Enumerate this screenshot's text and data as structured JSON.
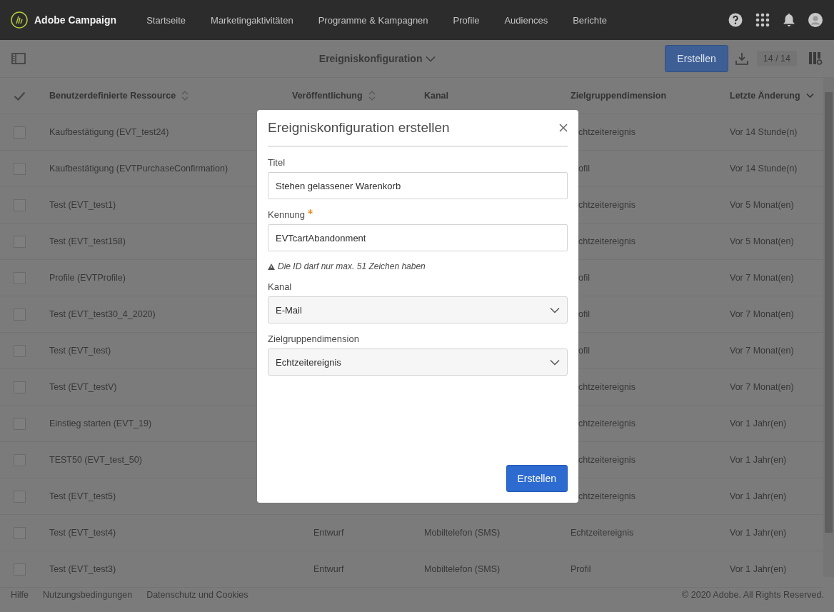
{
  "header": {
    "logo": "Adobe Campaign",
    "nav": [
      "Startseite",
      "Marketingaktivitäten",
      "Programme & Kampagnen",
      "Profile",
      "Audiences",
      "Berichte"
    ]
  },
  "toolbar": {
    "title": "Ereigniskonfiguration",
    "create_button": "Erstellen",
    "count": "14 / 14"
  },
  "table": {
    "columns": [
      {
        "label": "Benutzerdefinierte Ressource",
        "sortable": true,
        "sorted": false
      },
      {
        "label": "Veröffentlichung",
        "sortable": true,
        "sorted": false
      },
      {
        "label": "Kanal",
        "sortable": false,
        "sorted": false
      },
      {
        "label": "Zielgruppendimension",
        "sortable": false,
        "sorted": false
      },
      {
        "label": "Letzte Änderung",
        "sortable": true,
        "sorted": true
      }
    ],
    "rows": [
      {
        "checked": false,
        "name": "Kaufbestätigung (EVT_test24)",
        "audience": "chtzeitereignis",
        "changed": "Vor 14 Stunde(n)"
      },
      {
        "checked": false,
        "name": "Kaufbestätigung (EVTPurchaseConfirmation)",
        "audience": "ofil",
        "changed": "Vor 14 Stunde(n)"
      },
      {
        "checked": false,
        "name": "Test (EVT_test1)",
        "audience": "chtzeitereignis",
        "changed": "Vor 5 Monat(en)"
      },
      {
        "checked": false,
        "name": "Test (EVT_test158)",
        "audience": "chtzeitereignis",
        "changed": "Vor 5 Monat(en)"
      },
      {
        "checked": false,
        "name": "Profile (EVTProfile)",
        "audience": "ofil",
        "changed": "Vor 7 Monat(en)"
      },
      {
        "checked": false,
        "name": "Test (EVT_test30_4_2020)",
        "audience": "ofil",
        "changed": "Vor 7 Monat(en)"
      },
      {
        "checked": false,
        "name": "Test (EVT_test)",
        "audience": "ofil",
        "changed": "Vor 7 Monat(en)"
      },
      {
        "checked": false,
        "name": "Test (EVT_testV)",
        "audience": "chtzeitereignis",
        "changed": "Vor 7 Monat(en)"
      },
      {
        "checked": false,
        "name": "Einstieg starten (EVT_19)",
        "audience": "chtzeitereignis",
        "changed": "Vor 1 Jahr(en)"
      },
      {
        "checked": false,
        "name": "TEST50 (EVT_test_50)",
        "audience": "chtzeitereignis",
        "changed": "Vor 1 Jahr(en)"
      },
      {
        "checked": false,
        "name": "Test (EVT_test5)",
        "audience": "chtzeitereignis",
        "changed": "Vor 1 Jahr(en)"
      },
      {
        "checked": false,
        "name": "Test (EVT_test4)",
        "publication": "Entwurf",
        "channel": "Mobiltelefon (SMS)",
        "audience": "Echtzeitereignis",
        "changed": "Vor 1 Jahr(en)"
      },
      {
        "checked": false,
        "name": "Test (EVT_test3)",
        "publication": "Entwurf",
        "channel": "Mobiltelefon (SMS)",
        "audience": "Profil",
        "changed": "Vor 1 Jahr(en)"
      }
    ]
  },
  "dialog": {
    "title": "Ereigniskonfiguration erstellen",
    "fields": [
      {
        "kind": "text",
        "label": "Titel",
        "required": false,
        "value": "Stehen gelassener Warenkorb"
      },
      {
        "kind": "text",
        "label": "Kennung",
        "required": true,
        "value": "EVTcartAbandonment",
        "hint": "Die ID darf nur max. 51 Zeichen haben"
      },
      {
        "kind": "select",
        "label": "Kanal",
        "required": false,
        "value": "E-Mail"
      },
      {
        "kind": "select",
        "label": "Zielgruppendimension",
        "required": false,
        "value": "Echtzeitereignis"
      }
    ],
    "submit": "Erstellen"
  },
  "footer": {
    "links": [
      "Hilfe",
      "Nutzungsbedingungen",
      "Datenschutz und Cookies"
    ],
    "copyright": "© 2020 Adobe. All Rights Reserved."
  }
}
